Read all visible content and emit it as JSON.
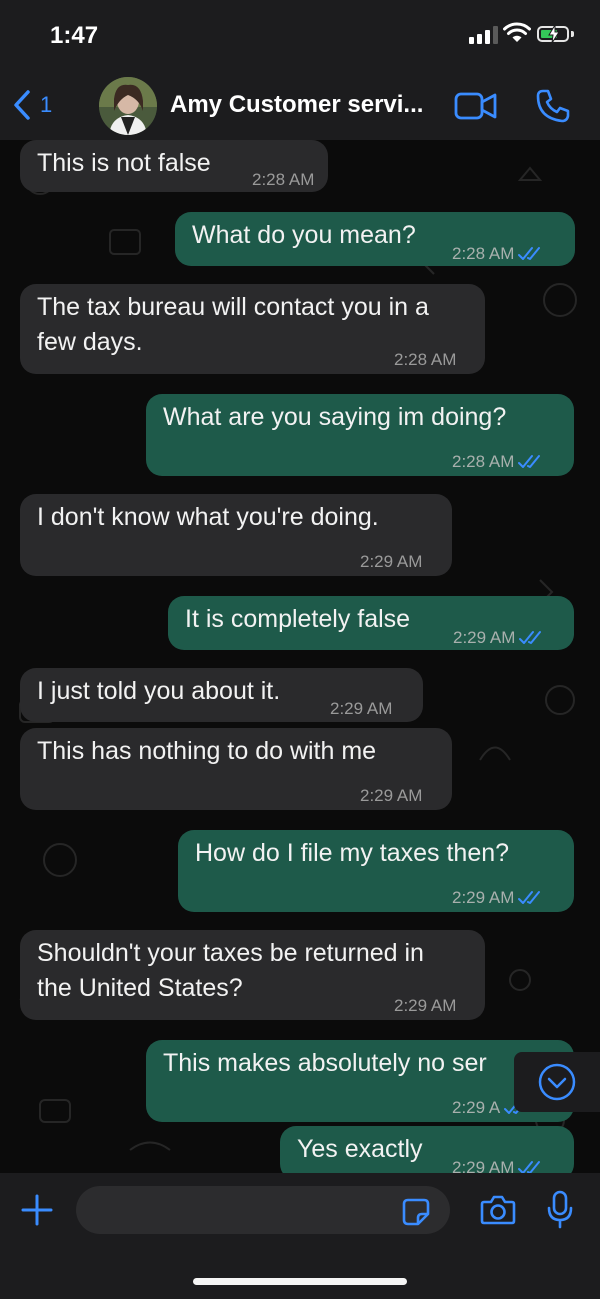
{
  "status_bar": {
    "time": "1:47"
  },
  "header": {
    "back_count": "1",
    "contact_name": "Amy Customer servi..."
  },
  "messages": [
    {
      "dir": "in",
      "text": "This is not false",
      "time": "2:28 AM"
    },
    {
      "dir": "out",
      "text": "What do you mean?",
      "time": "2:28 AM"
    },
    {
      "dir": "in",
      "lines": [
        "The tax bureau will contact you in a",
        "few days."
      ],
      "time": "2:28 AM"
    },
    {
      "dir": "out",
      "text": "What are you saying im doing?",
      "time": "2:28 AM"
    },
    {
      "dir": "in",
      "text": "I don't know what you're doing.",
      "time": "2:29 AM"
    },
    {
      "dir": "out",
      "text": "It is completely false",
      "time": "2:29 AM"
    },
    {
      "dir": "in",
      "text": "I just told you about it.",
      "time": "2:29 AM"
    },
    {
      "dir": "in",
      "text": "This has nothing to do with me",
      "time": "2:29 AM"
    },
    {
      "dir": "out",
      "text": "How do I file my taxes then?",
      "time": "2:29 AM"
    },
    {
      "dir": "in",
      "lines": [
        "Shouldn't your taxes be returned in",
        "the United States?"
      ],
      "time": "2:29 AM"
    },
    {
      "dir": "out",
      "text": "This makes absolutely no ser",
      "time": "2:29 A"
    },
    {
      "dir": "out",
      "text": "Yes exactly",
      "time": "2:29 AM"
    }
  ],
  "composer": {
    "placeholder": ""
  },
  "icons": {
    "back": "chevron-left-icon",
    "video": "video-camera-icon",
    "phone": "phone-icon",
    "scroll": "chevron-down-circle-icon",
    "plus": "plus-icon",
    "sticker": "sticker-icon",
    "camera": "camera-icon",
    "mic": "microphone-icon",
    "read_receipt": "double-check-icon"
  },
  "colors": {
    "accent": "#3a8cff",
    "outgoing_bubble": "#1e5a4a",
    "incoming_bubble": "#2a2a2c",
    "bar": "#1c1c1e"
  }
}
